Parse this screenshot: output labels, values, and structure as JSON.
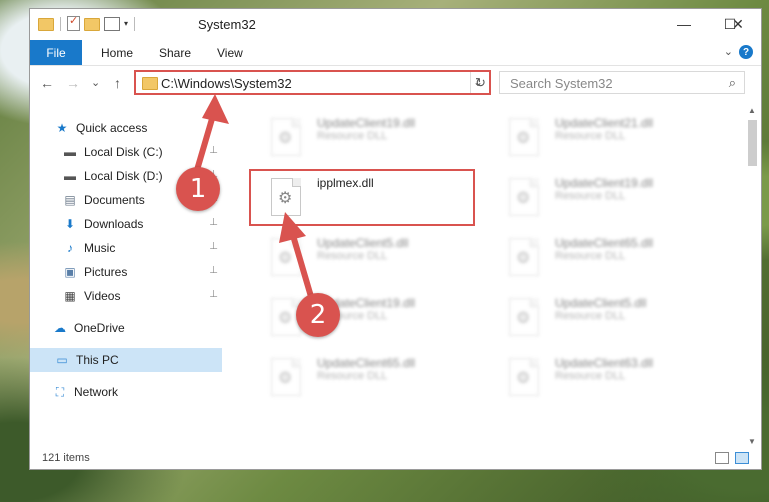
{
  "window": {
    "title": "System32",
    "controls": {
      "minimize": "—",
      "maximize": "☐",
      "close": "✕"
    }
  },
  "ribbon": {
    "tabs": [
      "File",
      "Home",
      "Share",
      "View"
    ],
    "expand_icon": "chevron-down-icon",
    "help": "?"
  },
  "nav": {
    "back": "←",
    "forward": "→",
    "recent": "⌄",
    "up": "↑",
    "address": "C:\\Windows\\System32",
    "refresh": "↻",
    "search_placeholder": "Search System32"
  },
  "sidebar": {
    "items": [
      {
        "label": "Quick access",
        "icon": "star-icon",
        "glyph": "★",
        "color": "#1979ca"
      },
      {
        "label": "Local Disk (C:)",
        "icon": "drive-icon",
        "glyph": "▬",
        "color": "#555555"
      },
      {
        "label": "Local Disk (D:)",
        "icon": "drive-icon",
        "glyph": "▬",
        "color": "#555555"
      },
      {
        "label": "Documents",
        "icon": "documents-icon",
        "glyph": "▤",
        "color": "#6b7a8a"
      },
      {
        "label": "Downloads",
        "icon": "download-icon",
        "glyph": "⬇",
        "color": "#1979ca"
      },
      {
        "label": "Music",
        "icon": "music-icon",
        "glyph": "♪",
        "color": "#1979ca"
      },
      {
        "label": "Pictures",
        "icon": "pictures-icon",
        "glyph": "▣",
        "color": "#5a7fa8"
      },
      {
        "label": "Videos",
        "icon": "videos-icon",
        "glyph": "▦",
        "color": "#444444"
      },
      {
        "label": "OneDrive",
        "icon": "cloud-icon",
        "glyph": "☁",
        "color": "#1979ca"
      },
      {
        "label": "This PC",
        "icon": "computer-icon",
        "glyph": "▭",
        "color": "#3c8ed6"
      },
      {
        "label": "Network",
        "icon": "network-icon",
        "glyph": "⛶",
        "color": "#3c8ed6"
      }
    ],
    "pin_glyph": "📌"
  },
  "files": [
    {
      "name": "UpdateClient19.dll",
      "type": "Resource DLL"
    },
    {
      "name": "UpdateClient21.dll",
      "type": "Resource DLL"
    },
    {
      "name": "ipplmex.dll",
      "type": ""
    },
    {
      "name": "UpdateClient19.dll",
      "type": "Resource DLL"
    },
    {
      "name": "UpdateClient5.dll",
      "type": "Resource DLL"
    },
    {
      "name": "UpdateClient65.dll",
      "type": "Resource DLL"
    },
    {
      "name": "UpdateClient19.dll",
      "type": "Resource DLL"
    },
    {
      "name": "UpdateClient5.dll",
      "type": "Resource DLL"
    },
    {
      "name": "UpdateClient65.dll",
      "type": "Resource DLL"
    },
    {
      "name": "UpdateClient63.dll",
      "type": "Resource DLL"
    }
  ],
  "status": {
    "items_count": "121 items"
  },
  "annotations": {
    "step1": "1",
    "step2": "2",
    "color": "#d9534f"
  }
}
